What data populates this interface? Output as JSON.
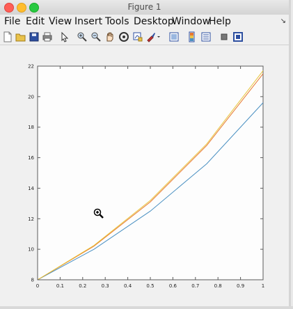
{
  "window": {
    "title": "Figure 1"
  },
  "menu": {
    "items": [
      "File",
      "Edit",
      "View",
      "Insert",
      "Tools",
      "Desktop",
      "Window",
      "Help"
    ]
  },
  "toolbar": {
    "icons": [
      "new-figure-icon",
      "open-file-icon",
      "save-icon",
      "print-icon",
      "pointer-icon",
      "zoom-in-icon",
      "zoom-out-icon",
      "pan-icon",
      "rotate-3d-icon",
      "data-cursor-icon",
      "brush-icon",
      "colorbar-icon",
      "legend-icon",
      "hide-plot-tools-icon",
      "show-plot-tools-icon"
    ]
  },
  "colors": {
    "series1": "#4a90c2",
    "series2": "#e8772e",
    "series3": "#e8c53a"
  },
  "chart_data": {
    "type": "line",
    "title": "",
    "xlabel": "",
    "ylabel": "",
    "xlim": [
      0,
      1
    ],
    "ylim": [
      8,
      22
    ],
    "xticks": [
      0,
      0.1,
      0.2,
      0.3,
      0.4,
      0.5,
      0.6,
      0.7,
      0.8,
      0.9,
      1
    ],
    "xtick_labels": [
      "0",
      "0.1",
      "0.2",
      "0.3",
      "0.4",
      "0.5",
      "0.6",
      "0.7",
      "0.8",
      "0.9",
      "1"
    ],
    "yticks": [
      8,
      10,
      12,
      14,
      16,
      18,
      20,
      22
    ],
    "ytick_labels": [
      "8",
      "10",
      "12",
      "14",
      "16",
      "18",
      "20",
      "22"
    ],
    "grid": false,
    "series": [
      {
        "x": [
          0,
          0.25,
          0.5,
          0.75,
          1
        ],
        "y": [
          8,
          10,
          12.5,
          15.6,
          19.6
        ]
      },
      {
        "x": [
          0,
          0.25,
          0.5,
          0.75,
          1
        ],
        "y": [
          8,
          10.2,
          13.1,
          16.8,
          21.5
        ]
      },
      {
        "x": [
          0,
          0.25,
          0.5,
          0.75,
          1
        ],
        "y": [
          8,
          10.25,
          13.2,
          16.9,
          21.7
        ]
      }
    ]
  }
}
